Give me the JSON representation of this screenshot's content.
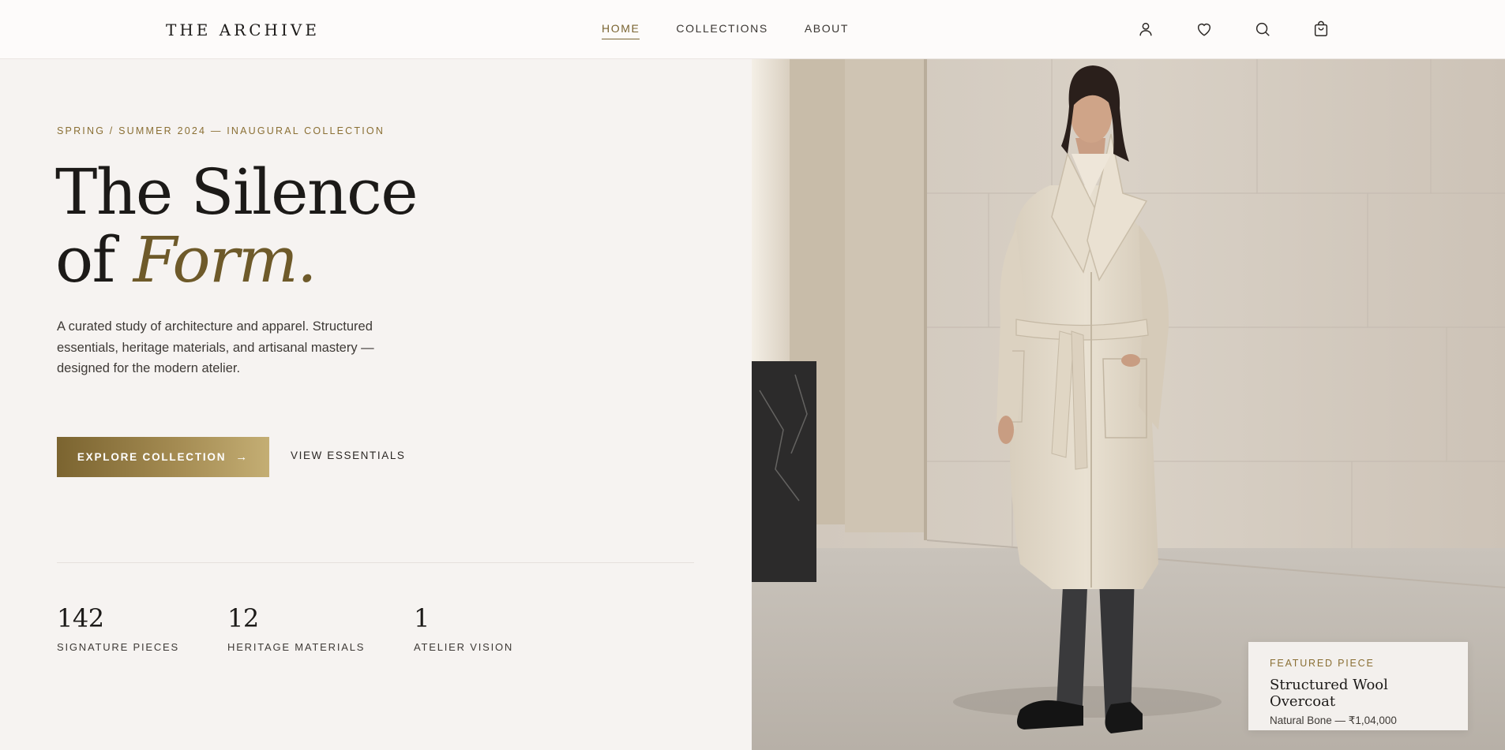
{
  "brand": "THE ARCHIVE",
  "nav": {
    "items": [
      {
        "label": "HOME",
        "active": true
      },
      {
        "label": "COLLECTIONS",
        "active": false
      },
      {
        "label": "ABOUT",
        "active": false
      }
    ]
  },
  "header_icons": [
    "user-icon",
    "heart-icon",
    "search-icon",
    "shopping-bag-icon"
  ],
  "hero": {
    "eyebrow": "SPRING / SUMMER 2024 — INAUGURAL COLLECTION",
    "headline_line1": "The Silence",
    "headline_line2_prefix": "of",
    "headline_line2_accent": "Form.",
    "lede": "A curated study of architecture and apparel. Structured essentials, heritage materials, and artisanal mastery — designed for the modern atelier.",
    "cta_primary": "EXPLORE COLLECTION",
    "cta_primary_icon": "→",
    "cta_secondary": "VIEW ESSENTIALS"
  },
  "stats": [
    {
      "value": "142",
      "label": "SIGNATURE PIECES"
    },
    {
      "value": "12",
      "label": "HERITAGE MATERIALS"
    },
    {
      "value": "1",
      "label": "ATELIER VISION"
    }
  ],
  "featured": {
    "label": "FEATURED PIECE",
    "title": "Structured Wool Overcoat",
    "subtitle": "Natural Bone — ₹1,04,000"
  },
  "colors": {
    "accent": "#7a6431",
    "background": "#f6f3f1",
    "text": "#1c1a18"
  }
}
